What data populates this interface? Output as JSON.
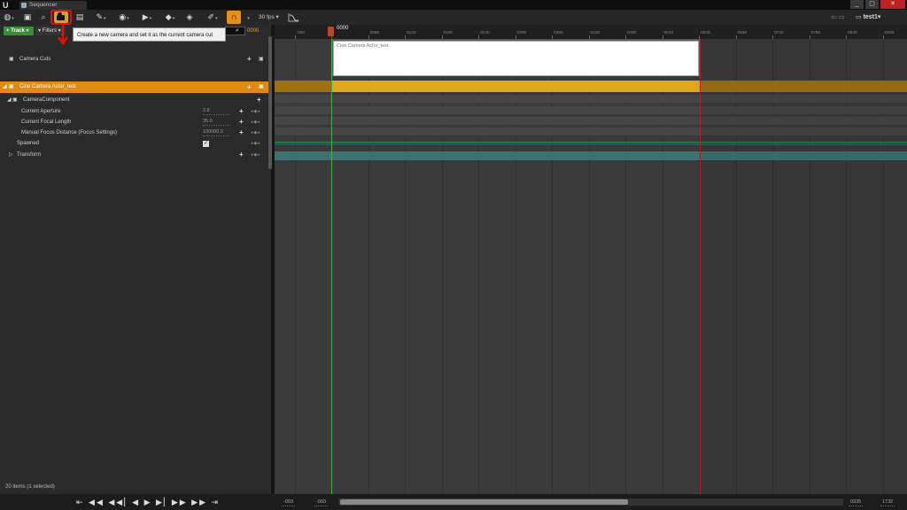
{
  "window": {
    "logo": "U",
    "tab_title": "Sequencer",
    "minimize": "_",
    "maximize": "▢",
    "close": "✕"
  },
  "toolbar": {
    "fps_label": "30 fps",
    "fps_dropdown": "▾",
    "sequence_name": "test1",
    "back_forward": "⇦ ⇨",
    "icons": [
      "world-icon",
      "save-icon",
      "search-icon",
      "camera-icon",
      "render-icon",
      "wrench-icon",
      "eye-icon",
      "play-icon",
      "key-icon",
      "diamond-icon",
      "brush-icon",
      "magnet-icon",
      "curve-icon",
      "folder-icon"
    ]
  },
  "tooltip": {
    "text": "Create a new camera and set it as the current camera cut"
  },
  "left_panel": {
    "track_button": "+ Track ▾",
    "filters_button": "▾ Filters ▾",
    "search_icon": "⌕",
    "time_readout": "0000",
    "rows": {
      "camera_cuts": "Camera Cuts",
      "cine_actor": "Cine Camera Actor_test",
      "camera_component": "CameraComponent",
      "aperture": "Current Aperture",
      "aperture_val": "2.8",
      "focal": "Current Focal Length",
      "focal_val": "35.0",
      "focus_dist": "Manual Focus Distance (Focus Settings)",
      "focus_dist_val": "100000.0",
      "spawned": "Spawned",
      "transform": "Transform"
    },
    "plus": "+",
    "keys": "◂◆▸",
    "items_status": "20 items (1 selected)"
  },
  "timeline": {
    "playhead_label": "0000",
    "cut_section_label": "Cine Camera Actor_test",
    "ruler_ticks": [
      "-060",
      "0000",
      "0060",
      "0120",
      "0180",
      "0240",
      "0300",
      "0360",
      "0420",
      "0480",
      "0540",
      "0600",
      "0660",
      "0720",
      "0780",
      "0840",
      "0900",
      "0960"
    ]
  },
  "bottom": {
    "transport": "⇤ ◀◀ ◀◀▏◀ ▶ ▶▏▶▶ ▶▶ ⇥",
    "range_start_view": "-093",
    "range_start_play": "-093",
    "range_end_play": "0935",
    "range_end_view": "1732"
  },
  "colors": {
    "accent_orange": "#e08a12",
    "highlight_red": "#e01010",
    "camera_button": "#d9a31a"
  }
}
